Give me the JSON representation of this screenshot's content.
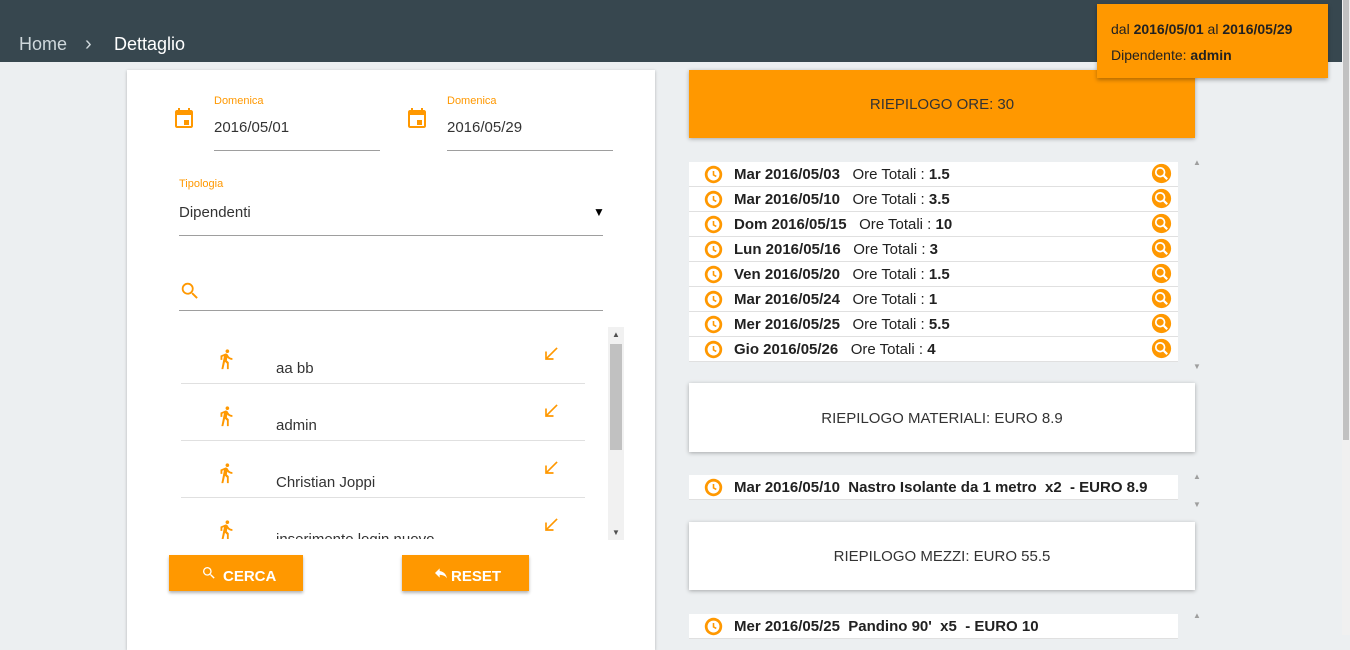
{
  "header": {
    "breadcrumb_home": "Home",
    "breadcrumb_current": "Dettaglio"
  },
  "info": {
    "from_prefix": "dal",
    "from_date": "2016/05/01",
    "to_prefix": "al",
    "to_date": "2016/05/29",
    "employee_label": "Dipendente:",
    "employee": "admin"
  },
  "filters": {
    "start": {
      "label": "Domenica",
      "value": "2016/05/01",
      "icon": "calendar-icon"
    },
    "end": {
      "label": "Domenica",
      "value": "2016/05/29",
      "icon": "calendar-icon"
    },
    "tipologia": {
      "label": "Tipologia",
      "value": "Dipendenti"
    },
    "search": {
      "icon": "search-icon",
      "value": ""
    }
  },
  "people": [
    {
      "name": "aa bb"
    },
    {
      "name": "admin"
    },
    {
      "name": "Christian Joppi"
    },
    {
      "name": "inserimento login nuovo"
    }
  ],
  "buttons": {
    "search": "CERCA",
    "reset": "RESET"
  },
  "hours_summary": "RIEPILOGO ORE: 30",
  "hours": [
    {
      "day": "Mar 2016/05/03",
      "label": "Ore Totali : ",
      "value": "1.5"
    },
    {
      "day": "Mar 2016/05/10",
      "label": "Ore Totali : ",
      "value": "3.5"
    },
    {
      "day": "Dom 2016/05/15",
      "label": "Ore Totali : ",
      "value": "10"
    },
    {
      "day": "Lun 2016/05/16",
      "label": "Ore Totali : ",
      "value": "3"
    },
    {
      "day": "Ven 2016/05/20",
      "label": "Ore Totali : ",
      "value": "1.5"
    },
    {
      "day": "Mar 2016/05/24",
      "label": "Ore Totali : ",
      "value": "1"
    },
    {
      "day": "Mer 2016/05/25",
      "label": "Ore Totali : ",
      "value": "5.5"
    },
    {
      "day": "Gio 2016/05/26",
      "label": "Ore Totali : ",
      "value": "4"
    }
  ],
  "materials_summary": "RIEPILOGO MATERIALI: EURO 8.9",
  "materials": [
    {
      "text": "Mar 2016/05/10  Nastro Isolante da 1 metro  x2  - EURO 8.9"
    }
  ],
  "vehicles_summary": "RIEPILOGO MEZZI: EURO 55.5",
  "vehicles": [
    {
      "text": "Mer 2016/05/25  Pandino 90'  x5  - EURO 10"
    }
  ],
  "colors": {
    "accent": "#ff9800",
    "header": "#37474f",
    "background": "#eceff1"
  }
}
